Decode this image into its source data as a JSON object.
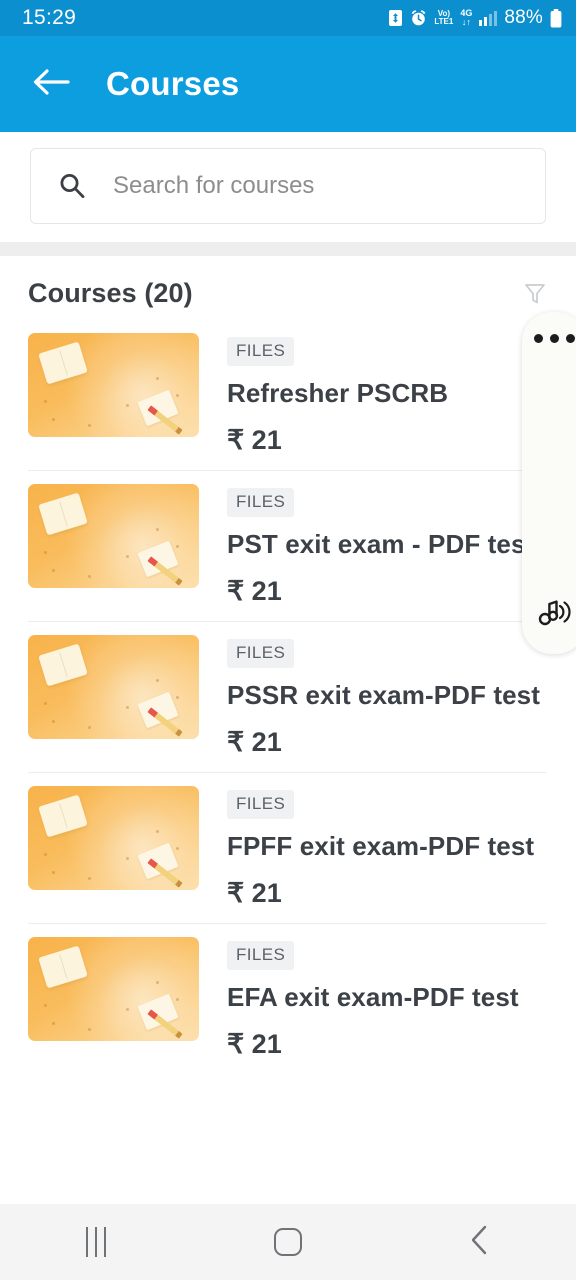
{
  "status_bar": {
    "time": "15:29",
    "battery_percent": "88%",
    "volte_label_top": "Vo)",
    "volte_label_bottom": "LTE1",
    "network_label_top": "4G",
    "network_label_bottom": "↓↑",
    "icons": [
      "battery-saver-icon",
      "alarm-icon",
      "volte-icon",
      "4g-data-icon",
      "signal-bars-icon",
      "battery-icon"
    ],
    "background_color": "#0b8fce"
  },
  "app_bar": {
    "title": "Courses",
    "back_icon": "arrow-left-icon",
    "background_color": "#0d9ee0",
    "text_color": "#ffffff"
  },
  "search": {
    "placeholder": "Search for courses",
    "value": "",
    "icon": "search-icon"
  },
  "list_header": {
    "title": "Courses (20)",
    "filter_icon": "filter-funnel-icon"
  },
  "courses": [
    {
      "badge": "FILES",
      "title": "Refresher PSCRB",
      "price": "₹ 21",
      "thumbnail": "course-thumbnail-books"
    },
    {
      "badge": "FILES",
      "title": "PST exit exam - PDF test",
      "price": "₹ 21",
      "thumbnail": "course-thumbnail-books"
    },
    {
      "badge": "FILES",
      "title": "PSSR exit exam-PDF test",
      "price": "₹ 21",
      "thumbnail": "course-thumbnail-books"
    },
    {
      "badge": "FILES",
      "title": "FPFF exit exam-PDF test",
      "price": "₹ 21",
      "thumbnail": "course-thumbnail-books"
    },
    {
      "badge": "FILES",
      "title": "EFA exit exam-PDF test",
      "price": "₹ 21",
      "thumbnail": "course-thumbnail-books"
    }
  ],
  "edge_panel": {
    "handle_icon": "more-dots-icon",
    "music_icon": "music-note-icon"
  },
  "nav_bar": {
    "recents_icon": "recents-icon",
    "home_icon": "home-icon",
    "back_icon": "back-chevron-icon"
  }
}
